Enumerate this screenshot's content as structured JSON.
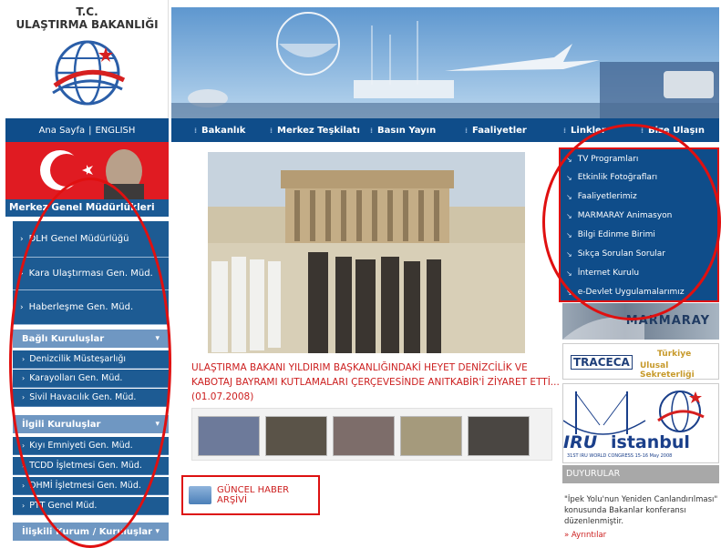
{
  "header": {
    "org_line1": "T.C.",
    "org_line2": "ULAŞTIRMA BAKANLIĞI"
  },
  "left_nav": {
    "home_link": "Ana Sayfa",
    "separator": "|",
    "english_link": "ENGLISH",
    "merkez_title": "Merkez Genel Müdürlükleri",
    "merkez_items": [
      "DLH Genel Müdürlüğü",
      "Kara Ulaştırması Gen. Müd.",
      "Haberleşme Gen. Müd."
    ],
    "bagli_title": "Bağlı Kuruluşlar",
    "bagli_items": [
      "Denizcilik Müsteşarlığı",
      "Karayolları Gen. Müd.",
      "Sivil Havacılık Gen. Müd."
    ],
    "ilgili_title": "İlgili Kuruluşlar",
    "ilgili_items": [
      "Kıyı Emniyeti Gen. Müd.",
      "TCDD İşletmesi Gen. Müd.",
      "DHMİ İşletmesi Gen. Müd.",
      "PTT Genel Müd."
    ],
    "iliskili_title": "İlişkili Kurum / Kuruluşlar"
  },
  "main_nav": {
    "items": [
      "Bakanlık",
      "Merkez Teşkilatı",
      "Basın Yayın",
      "Faaliyetler",
      "Linkler",
      "Bize Ulaşın"
    ]
  },
  "news": {
    "headline": "ULAŞTIRMA BAKANI YILDIRIM BAŞKANLIĞINDAKİ HEYET DENİZCİLİK VE KABOTAJ BAYRAMI KUTLAMALARI ÇERÇEVESİNDE ANITKABİR'İ ZİYARET ETTİ...",
    "date": "(01.07.2008)",
    "archive_label": "GÜNCEL HABER ARŞİVİ"
  },
  "right_menu": {
    "items": [
      "TV Programları",
      "Etkinlik Fotoğrafları",
      "Faaliyetlerimiz",
      "MARMARAY Animasyon",
      "Bilgi Edinme Birimi",
      "Sıkça Sorulan Sorular",
      "İnternet Kurulu",
      "e-Devlet Uygulamalarımız"
    ]
  },
  "banners": {
    "marmaray": "MARMARAY",
    "traceca_logo": "TRACECA",
    "traceca_line1": "Türkiye",
    "traceca_line2": "Ulusal Sekreterliği",
    "iru_word": "IRU",
    "iru_city": "istanbul",
    "iru_sub": "31ST IRU WORLD CONGRESS 15-16 May 2008"
  },
  "announcements": {
    "title": "DUYURULAR",
    "text": "\"İpek Yolu'nun Yeniden Canlandırılması\" konusunda Bakanlar konferansı düzenlenmiştir.",
    "more": "» Ayrıntılar"
  },
  "colors": {
    "nav_blue": "#0f4d8a",
    "accent_red": "#cc1f1f",
    "group_blue": "#6f97c2"
  }
}
